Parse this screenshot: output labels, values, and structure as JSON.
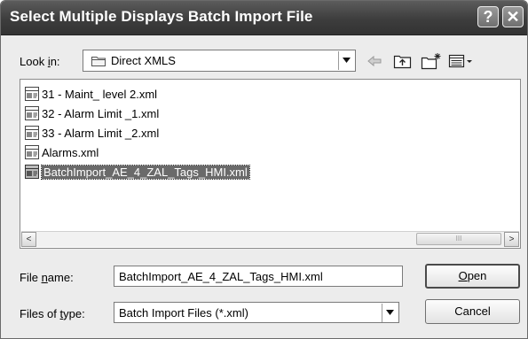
{
  "window": {
    "title": "Select Multiple Displays Batch Import File",
    "help_glyph": "?",
    "close_glyph": "✕"
  },
  "lookin": {
    "label_pre": "Look ",
    "label_mnemonic": "i",
    "label_post": "n:",
    "value": "Direct XMLS"
  },
  "toolbar": [
    "back-icon",
    "up-folder-icon",
    "new-folder-icon",
    "view-menu-icon"
  ],
  "files": [
    {
      "name": "31 - Maint_ level 2.xml",
      "selected": false
    },
    {
      "name": "32 - Alarm Limit _1.xml",
      "selected": false
    },
    {
      "name": "33 - Alarm Limit _2.xml",
      "selected": false
    },
    {
      "name": "Alarms.xml",
      "selected": false
    },
    {
      "name": "BatchImport_AE_4_ZAL_Tags_HMI.xml",
      "selected": true
    }
  ],
  "scrollbar": {
    "left_glyph": "<",
    "right_glyph": ">",
    "thumb_grip": "III"
  },
  "filename": {
    "label_pre": "File ",
    "label_mnemonic": "n",
    "label_post": "ame:",
    "value": "BatchImport_AE_4_ZAL_Tags_HMI.xml"
  },
  "filetype": {
    "label_pre": "Files of ",
    "label_mnemonic": "t",
    "label_post": "ype:",
    "value": "Batch Import Files (*.xml)"
  },
  "buttons": {
    "open_mnemonic": "O",
    "open_rest": "pen",
    "cancel": "Cancel"
  }
}
